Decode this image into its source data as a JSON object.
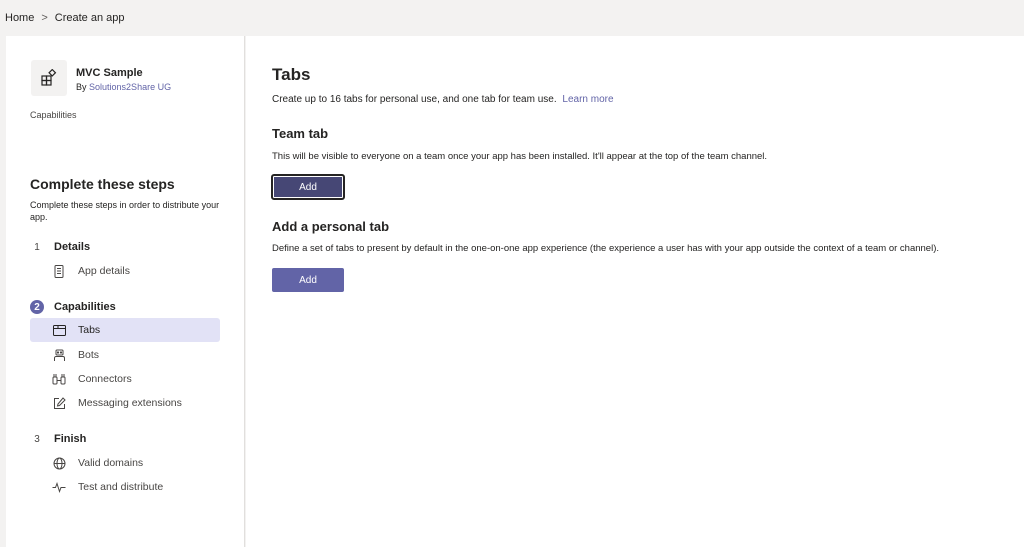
{
  "breadcrumb": {
    "home": "Home",
    "separator": ">",
    "current": "Create an app"
  },
  "app": {
    "name": "MVC Sample",
    "by_prefix": "By",
    "publisher": "Solutions2Share UG",
    "section_label": "Capabilities",
    "icon": "apps-icon"
  },
  "steps": {
    "title": "Complete these steps",
    "description": "Complete these steps in order to distribute your app.",
    "groups": [
      {
        "number": "1",
        "label": "Details",
        "items": [
          {
            "label": "App details",
            "icon": "document-icon"
          }
        ]
      },
      {
        "number": "2",
        "label": "Capabilities",
        "items": [
          {
            "label": "Tabs",
            "icon": "tab-icon"
          },
          {
            "label": "Bots",
            "icon": "bot-icon"
          },
          {
            "label": "Connectors",
            "icon": "connector-icon"
          },
          {
            "label": "Messaging extensions",
            "icon": "edit-icon"
          }
        ]
      },
      {
        "number": "3",
        "label": "Finish",
        "items": [
          {
            "label": "Valid domains",
            "icon": "globe-icon"
          },
          {
            "label": "Test and distribute",
            "icon": "pulse-icon"
          }
        ]
      }
    ]
  },
  "main": {
    "title": "Tabs",
    "description": "Create up to 16 tabs for personal use, and one tab for team use.",
    "learn_more": "Learn more",
    "team_tab": {
      "title": "Team tab",
      "description": "This will be visible to everyone on a team once your app has been installed. It'll appear at the top of the team channel.",
      "button": "Add"
    },
    "personal_tab": {
      "title": "Add a personal tab",
      "description": "Define a set of tabs to present by default in the one-on-one app experience (the experience a user has with your app outside the context of a team or channel).",
      "button": "Add"
    }
  },
  "colors": {
    "accent": "#6264a7",
    "accent_dark": "#464775",
    "selected_bg": "#e2e2f6"
  }
}
